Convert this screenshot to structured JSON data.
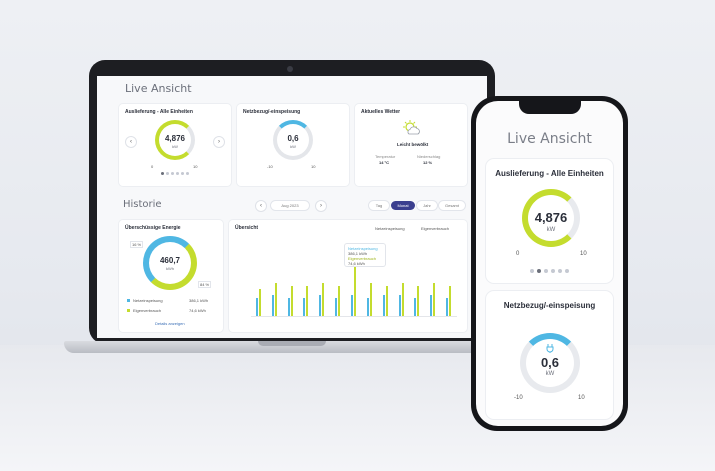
{
  "laptop": {
    "screen_title": "Live Ansicht",
    "cards": [
      {
        "title": "Auslieferung - Alle Einheiten",
        "value": "4,876",
        "unit": "kW",
        "min": "0",
        "max": "10"
      },
      {
        "title": "Netzbezug/-einspeisung",
        "value": "0,6",
        "unit": "kW",
        "min": "-10",
        "max": "10"
      },
      {
        "title": "Aktuelles Wetter",
        "status": "Leicht bewölkt",
        "temp_label": "Temperatur",
        "temp": "14 °C",
        "rain_label": "Niederschlag",
        "rain": "12 %"
      }
    ],
    "nav": {
      "prev": "‹",
      "next": "›"
    },
    "history": {
      "title": "Historie",
      "date": "Aug 2023",
      "periods": [
        "Tag",
        "Monat",
        "Jahr",
        "Gesamt"
      ],
      "active_period": "Monat",
      "donut": {
        "title": "Überschüssige Energie",
        "value": "460,7",
        "unit": "kWh",
        "left_tag": "16 %",
        "right_tag": "84 %",
        "legend": [
          {
            "label": "Netzeinspeisung",
            "value": "386,1 kWh"
          },
          {
            "label": "Eigenverbrauch",
            "value": "74,6 kWh"
          }
        ],
        "link": "Details anzeigen"
      },
      "chart": {
        "title": "Übersicht",
        "legend": [
          "Netzeinspeisung",
          "Eigenverbrauch"
        ],
        "tooltip": [
          "Netzeinspeisung",
          "386,1 kWh",
          "Eigenverbrauch",
          "74,6 kWh"
        ]
      }
    }
  },
  "phone": {
    "title": "Live Ansicht",
    "card1": {
      "title": "Auslieferung - Alle Einheiten",
      "value": "4,876",
      "unit": "kW",
      "min": "0",
      "max": "10"
    },
    "card2": {
      "title": "Netzbezug/-einspeisung",
      "value": "0,6",
      "unit": "kW",
      "min": "-10",
      "max": "10"
    }
  },
  "chart_data": {
    "type": "bar",
    "series": [
      {
        "name": "Netzeinspeisung",
        "color": "#4fb7e3",
        "values": [
          6,
          7,
          6,
          6,
          7,
          6,
          7,
          6,
          7,
          7,
          6,
          7,
          6
        ]
      },
      {
        "name": "Eigenverbrauch",
        "color": "#c4dc2e",
        "values": [
          9,
          11,
          10,
          10,
          11,
          10,
          22,
          11,
          10,
          11,
          10,
          11,
          10
        ]
      }
    ],
    "ylim": [
      0,
      25
    ]
  },
  "colors": {
    "accent_green": "#c4dc2e",
    "accent_blue": "#4fb7e3",
    "active_pill": "#3b3f8f"
  }
}
